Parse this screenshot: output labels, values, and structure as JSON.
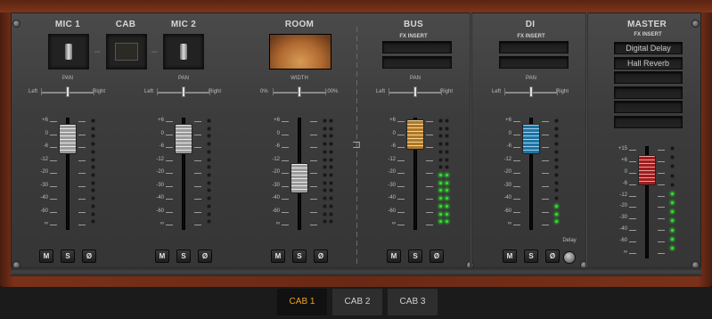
{
  "channels": {
    "mic1": {
      "title": "MIC 1",
      "pan_label": "PAN",
      "pan_left": "Left",
      "pan_right": "Right",
      "mute": "M",
      "solo": "S",
      "phase": "Ø"
    },
    "cab": {
      "title": "CAB"
    },
    "mic2": {
      "title": "MIC 2",
      "pan_label": "PAN",
      "pan_left": "Left",
      "pan_right": "Right",
      "mute": "M",
      "solo": "S",
      "phase": "Ø"
    },
    "room": {
      "title": "ROOM",
      "width_label": "WIDTH",
      "width_min": "0%",
      "width_max": "100%",
      "mute": "M",
      "solo": "S",
      "phase": "Ø"
    },
    "bus": {
      "title": "BUS",
      "fx_label": "FX INSERT",
      "pan_label": "PAN",
      "pan_left": "Left",
      "pan_right": "Right",
      "mute": "M",
      "solo": "S",
      "phase": "Ø"
    },
    "di": {
      "title": "DI",
      "fx_label": "FX INSERT",
      "pan_label": "PAN",
      "pan_left": "Left",
      "pan_right": "Right",
      "mute": "M",
      "solo": "S",
      "phase": "Ø",
      "delay_label": "Delay"
    },
    "master": {
      "title": "MASTER",
      "fx_label": "FX INSERT",
      "fx_slots": [
        "Digital Delay",
        "Hall Reverb",
        "",
        "",
        "",
        ""
      ]
    }
  },
  "fader_scale": [
    "+6",
    "0",
    "-6",
    "-12",
    "-20",
    "-30",
    "-40",
    "-60",
    "∞"
  ],
  "master_scale": [
    "+15",
    "+6",
    "0",
    "-6",
    "-12",
    "-20",
    "-30",
    "-40",
    "-60",
    "∞"
  ],
  "colors": {
    "bus_fader": "#e8a030",
    "di_fader": "#2a9ad8",
    "master_fader": "#d42828",
    "fader_default": "#cfcfcf",
    "meter_on": "#3ddc3d",
    "tab_selected_text": "#f0a020"
  },
  "tabs": [
    {
      "label": "CAB 1",
      "selected": true
    },
    {
      "label": "CAB 2",
      "selected": false
    },
    {
      "label": "CAB 3",
      "selected": false
    }
  ]
}
